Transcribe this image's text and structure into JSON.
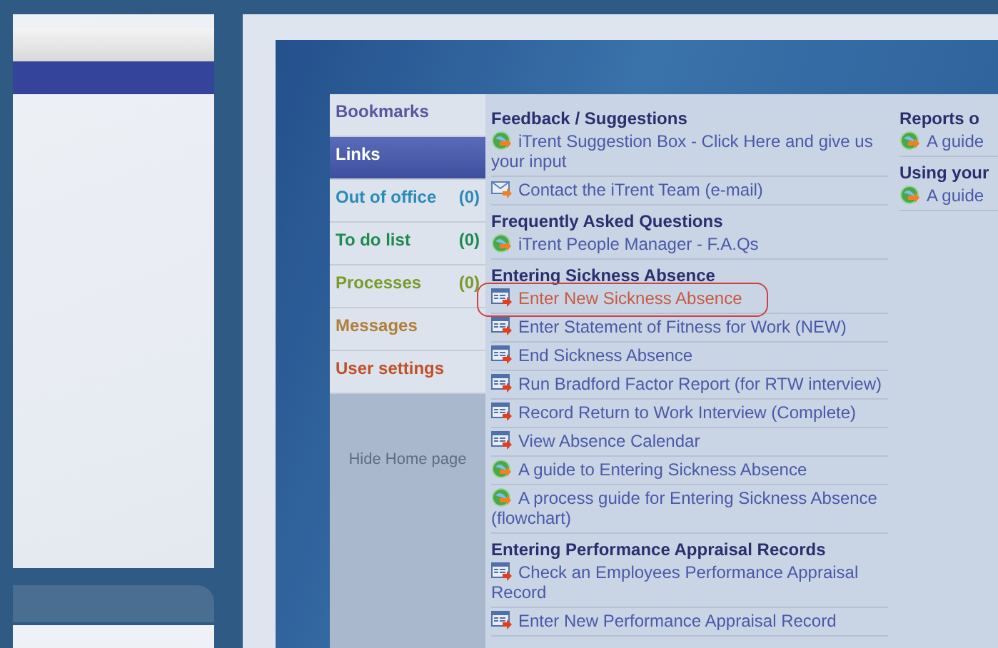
{
  "sidebar": {
    "items": [
      {
        "label": "Bookmarks",
        "color": "#5a55a0",
        "selected": false
      },
      {
        "label": "Links",
        "color": "#ffffff",
        "selected": true
      },
      {
        "label": "Out of office",
        "count": "(0)",
        "color": "#2a8ab8",
        "selected": false
      },
      {
        "label": "To do list",
        "count": "(0)",
        "color": "#1f8a50",
        "selected": false
      },
      {
        "label": "Processes",
        "count": "(0)",
        "color": "#7a9a2a",
        "selected": false
      },
      {
        "label": "Messages",
        "color": "#b0803a",
        "selected": false
      },
      {
        "label": "User settings",
        "color": "#c0502a",
        "selected": false
      }
    ],
    "hide_link": "Hide Home page"
  },
  "sections": [
    {
      "title": "Feedback / Suggestions",
      "links": [
        {
          "kind": "globe",
          "text": "iTrent Suggestion Box - Click Here and give us your input",
          "highlighted": false
        },
        {
          "kind": "mail",
          "text": "Contact the iTrent Team (e-mail)",
          "highlighted": false
        }
      ]
    },
    {
      "title": "Frequently Asked Questions",
      "links": [
        {
          "kind": "globe",
          "text": "iTrent People Manager - F.A.Qs",
          "highlighted": false
        }
      ]
    },
    {
      "title": "Entering Sickness Absence",
      "links": [
        {
          "kind": "form",
          "text": "Enter New Sickness Absence",
          "highlighted": true
        },
        {
          "kind": "form",
          "text": "Enter Statement of Fitness for Work (NEW)",
          "highlighted": false
        },
        {
          "kind": "form",
          "text": "End Sickness Absence",
          "highlighted": false
        },
        {
          "kind": "form",
          "text": "Run Bradford Factor Report (for RTW interview)",
          "highlighted": false
        },
        {
          "kind": "form",
          "text": "Record Return to Work Interview (Complete)",
          "highlighted": false
        },
        {
          "kind": "form",
          "text": "View Absence Calendar",
          "highlighted": false
        },
        {
          "kind": "globe",
          "text": "A guide to Entering Sickness Absence",
          "highlighted": false
        },
        {
          "kind": "globe",
          "text": "A process guide for Entering Sickness Absence (flowchart)",
          "highlighted": false
        }
      ]
    },
    {
      "title": "Entering Performance Appraisal Records",
      "links": [
        {
          "kind": "form",
          "text": "Check an Employees Performance Appraisal Record",
          "highlighted": false
        },
        {
          "kind": "form",
          "text": "Enter New Performance Appraisal Record",
          "highlighted": false
        }
      ]
    }
  ],
  "side_sections": [
    {
      "title": "Reports o",
      "links": [
        {
          "kind": "globe",
          "text": "A guide",
          "highlighted": false
        }
      ]
    },
    {
      "title": "Using your",
      "links": [
        {
          "kind": "globe",
          "text": "A guide",
          "highlighted": false
        }
      ]
    }
  ]
}
